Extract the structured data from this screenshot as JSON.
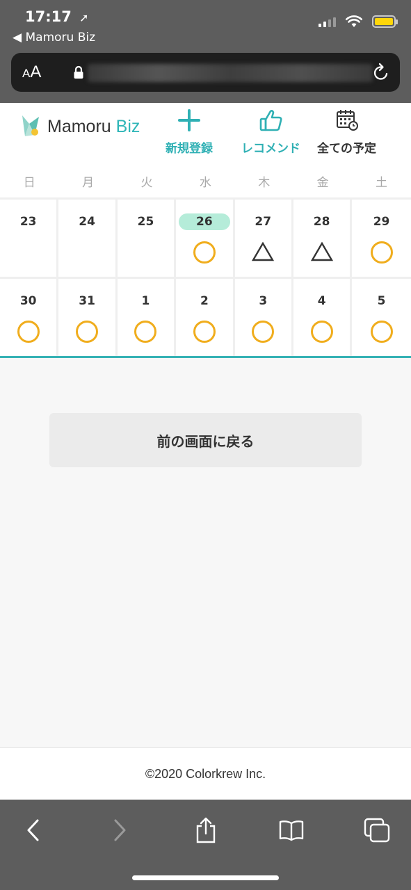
{
  "status": {
    "time": "17:17",
    "location_icon": "location-arrow-icon",
    "back_app": "◀ Mamoru Biz"
  },
  "browser": {
    "aa_small": "A",
    "aa_large": "A"
  },
  "header": {
    "logo_main": "Mamoru ",
    "logo_biz": "Biz",
    "nav": {
      "new": "新規登録",
      "recommend": "レコメンド",
      "all": "全ての予定"
    }
  },
  "calendar": {
    "weekdays": [
      "日",
      "月",
      "火",
      "水",
      "木",
      "金",
      "土"
    ],
    "weeks": [
      [
        {
          "day": "23",
          "mark": "none"
        },
        {
          "day": "24",
          "mark": "none"
        },
        {
          "day": "25",
          "mark": "none"
        },
        {
          "day": "26",
          "mark": "circle",
          "today": true
        },
        {
          "day": "27",
          "mark": "triangle"
        },
        {
          "day": "28",
          "mark": "triangle"
        },
        {
          "day": "29",
          "mark": "circle"
        }
      ],
      [
        {
          "day": "30",
          "mark": "circle"
        },
        {
          "day": "31",
          "mark": "circle"
        },
        {
          "day": "1",
          "mark": "circle"
        },
        {
          "day": "2",
          "mark": "circle"
        },
        {
          "day": "3",
          "mark": "circle"
        },
        {
          "day": "4",
          "mark": "circle"
        },
        {
          "day": "5",
          "mark": "circle"
        }
      ]
    ]
  },
  "main": {
    "back_button": "前の画面に戻る"
  },
  "footer": {
    "copyright": "©2020 Colorkrew Inc."
  },
  "colors": {
    "accent": "#2fb0b4",
    "circle": "#f0ad1d",
    "today": "#b5ecd9"
  }
}
